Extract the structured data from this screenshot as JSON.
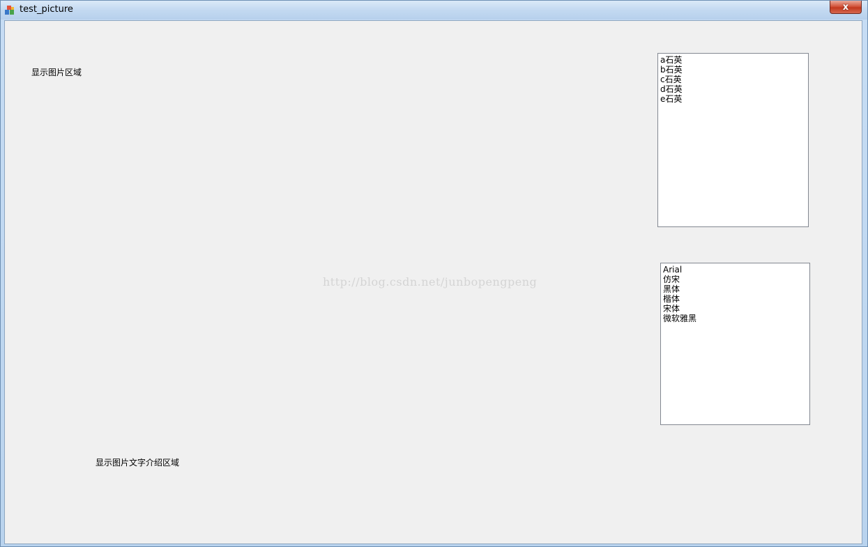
{
  "window": {
    "title": "test_picture",
    "close_label": "x"
  },
  "labels": {
    "image_area": "显示图片区域",
    "text_area": "显示图片文字介绍区域"
  },
  "list_quartz": {
    "items": [
      "a石英",
      "b石英",
      "c石英",
      "d石英",
      "e石英"
    ]
  },
  "list_fonts": {
    "items": [
      "Arial",
      "仿宋",
      "黑体",
      "楷体",
      "宋体",
      "微软雅黑"
    ]
  },
  "watermark": "http://blog.csdn.net/junbopengpeng"
}
